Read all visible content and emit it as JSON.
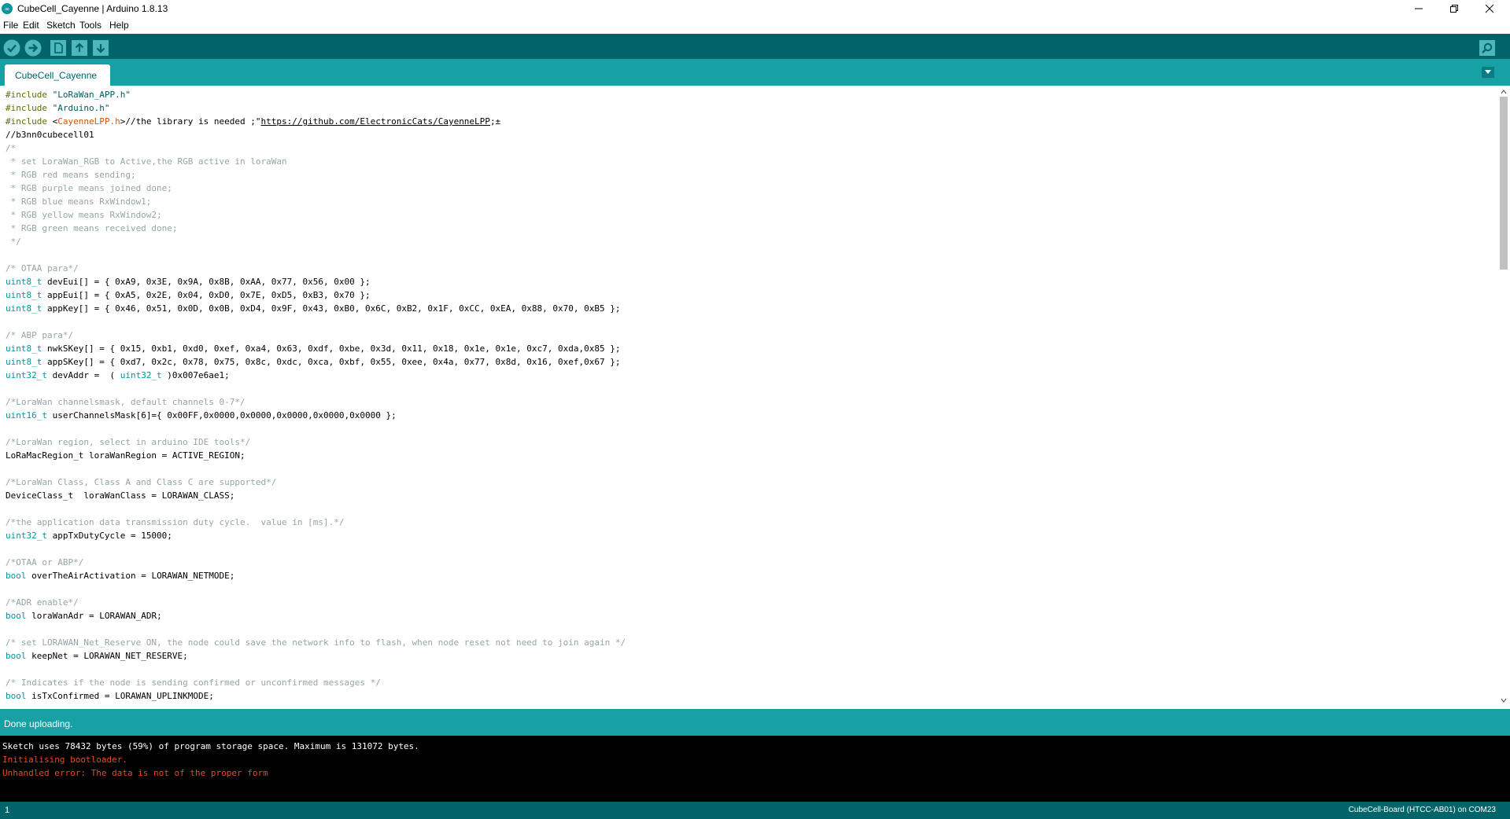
{
  "window": {
    "title": "CubeCell_Cayenne | Arduino 1.8.13"
  },
  "menu": {
    "items": [
      "File",
      "Edit",
      "Sketch",
      "Tools",
      "Help"
    ]
  },
  "toolbar": {
    "verify_icon": "check-icon",
    "upload_icon": "arrow-right-icon",
    "new_icon": "new-file-icon",
    "open_icon": "arrow-up-icon",
    "save_icon": "arrow-down-icon",
    "serial_monitor_icon": "magnifier-icon"
  },
  "tab": {
    "label": "CubeCell_Cayenne"
  },
  "editor": {
    "lines": [
      "#include \"LoRaWan_APP.h\"",
      "#include \"Arduino.h\"",
      "#include <CayenneLPP.h>//the library is needed ;\"https://github.com/ElectronicCats/CayenneLPP;±",
      "//b3nn0cubecell01",
      "/*",
      " * set LoraWan_RGB to Active,the RGB active in loraWan",
      " * RGB red means sending;",
      " * RGB purple means joined done;",
      " * RGB blue means RxWindow1;",
      " * RGB yellow means RxWindow2;",
      " * RGB green means received done;",
      " */",
      "",
      "/* OTAA para*/",
      "uint8_t devEui[] = { 0xA9, 0x3E, 0x9A, 0x8B, 0xAA, 0x77, 0x56, 0x00 };",
      "uint8_t appEui[] = { 0xA5, 0x2E, 0x04, 0xD0, 0x7E, 0xD5, 0xB3, 0x70 };",
      "uint8_t appKey[] = { 0x46, 0x51, 0x0D, 0x0B, 0xD4, 0x9F, 0x43, 0xB0, 0x6C, 0xB2, 0x1F, 0xCC, 0xEA, 0x88, 0x70, 0xB5 };",
      "",
      "/* ABP para*/",
      "uint8_t nwkSKey[] = { 0x15, 0xb1, 0xd0, 0xef, 0xa4, 0x63, 0xdf, 0xbe, 0x3d, 0x11, 0x18, 0x1e, 0x1e, 0xc7, 0xda,0x85 };",
      "uint8_t appSKey[] = { 0xd7, 0x2c, 0x78, 0x75, 0x8c, 0xdc, 0xca, 0xbf, 0x55, 0xee, 0x4a, 0x77, 0x8d, 0x16, 0xef,0x67 };",
      "uint32_t devAddr =  ( uint32_t )0x007e6ae1;",
      "",
      "/*LoraWan channelsmask, default channels 0-7*/",
      "uint16_t userChannelsMask[6]={ 0x00FF,0x0000,0x0000,0x0000,0x0000,0x0000 };",
      "",
      "/*LoraWan region, select in arduino IDE tools*/",
      "LoRaMacRegion_t loraWanRegion = ACTIVE_REGION;",
      "",
      "/*LoraWan Class, Class A and Class C are supported*/",
      "DeviceClass_t  loraWanClass = LORAWAN_CLASS;",
      "",
      "/*the application data transmission duty cycle.  value in [ms].*/",
      "uint32_t appTxDutyCycle = 15000;",
      "",
      "/*OTAA or ABP*/",
      "bool overTheAirActivation = LORAWAN_NETMODE;",
      "",
      "/*ADR enable*/",
      "bool loraWanAdr = LORAWAN_ADR;",
      "",
      "/* set LORAWAN_Net_Reserve ON, the node could save the network info to flash, when node reset not need to join again */",
      "bool keepNet = LORAWAN_NET_RESERVE;",
      "",
      "/* Indicates if the node is sending confirmed or unconfirmed messages */",
      "bool isTxConfirmed = LORAWAN_UPLINKMODE;"
    ]
  },
  "status": {
    "message": "Done uploading."
  },
  "console": {
    "lines": [
      {
        "text": "Sketch uses 78432 bytes (59%) of program storage space. Maximum is 131072 bytes.",
        "color": "#ffffff"
      },
      {
        "text": "Initialising bootloader.",
        "color": "#e34c22"
      },
      {
        "text": "Unhandled error: The data is not of the proper form",
        "color": "#e34c22"
      }
    ]
  },
  "bottom": {
    "line_number": "1",
    "board": "CubeCell-Board (HTCC-AB01) on COM23"
  },
  "colors": {
    "toolbar": "#006468",
    "tabstrip": "#17a1a5",
    "keyword": "#00979c",
    "comment": "#95a5a6",
    "error": "#e34c22"
  }
}
